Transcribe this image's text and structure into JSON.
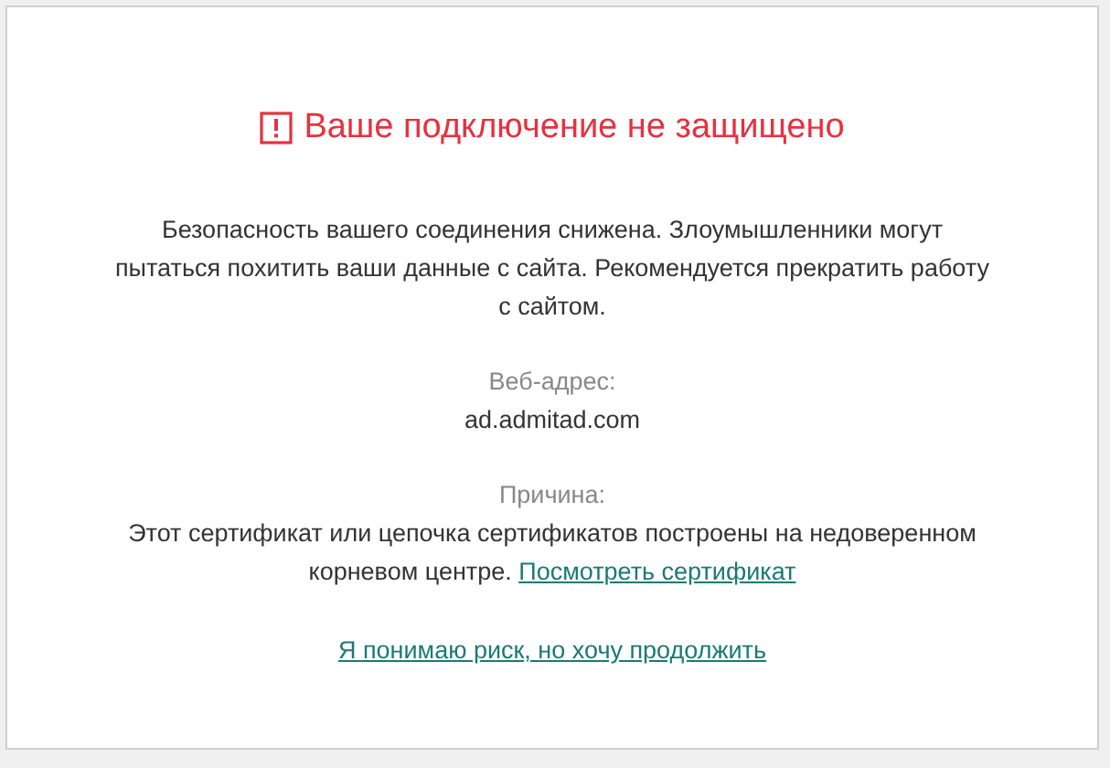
{
  "title": "Ваше подключение не защищено",
  "message": "Безопасность вашего соединения снижена. Злоумышленники могут пытаться похитить ваши данные с сайта. Рекомендуется прекратить работу с сайтом.",
  "address": {
    "label": "Веб-адрес:",
    "value": "ad.admitad.com"
  },
  "reason": {
    "label": "Причина:",
    "text": "Этот сертификат или цепочка сертификатов построены на недоверенном корневом центре.",
    "link": "Посмотреть сертификат"
  },
  "continue_link": "Я понимаю риск, но хочу продолжить"
}
